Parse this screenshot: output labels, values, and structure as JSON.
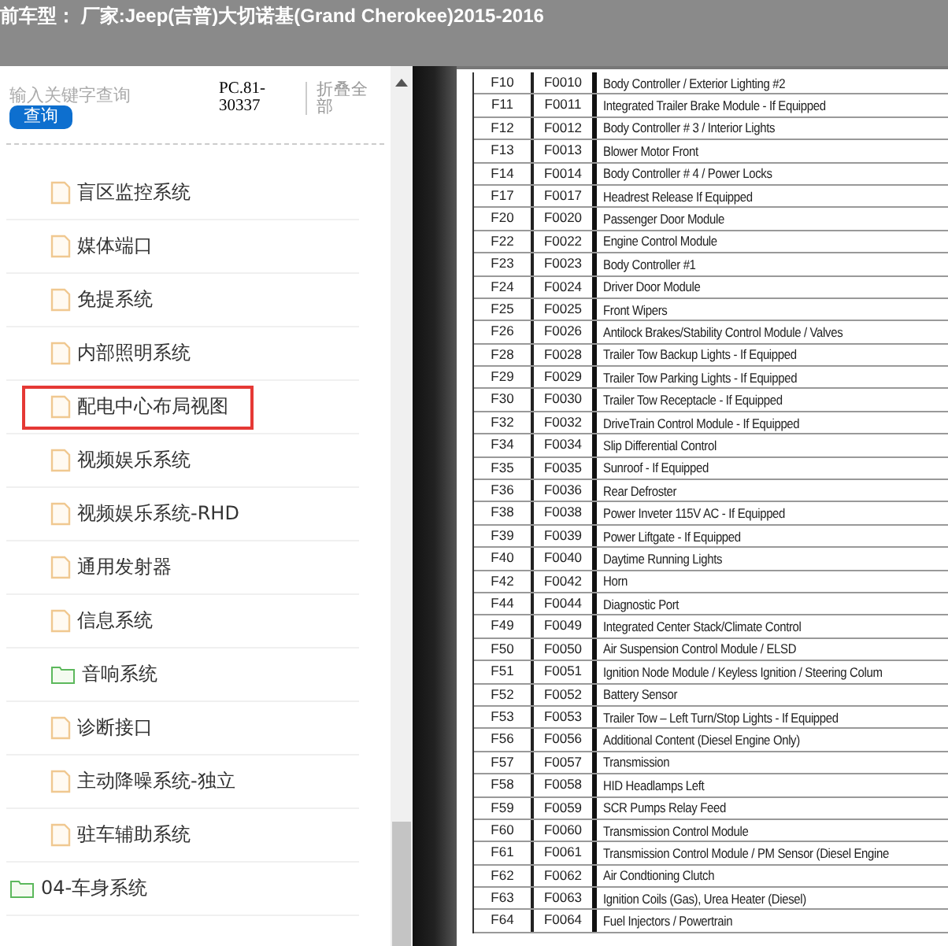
{
  "header": {
    "title": "前车型： 厂家:Jeep(吉普)大切诺基(Grand Cherokee)2015-2016"
  },
  "search": {
    "placeholder": "输入关键字查询",
    "button": "查询"
  },
  "code": "PC.81-30337",
  "collapse": "折叠全部",
  "tree": [
    {
      "kind": "group",
      "children": [
        {
          "label": "盲区监控系统",
          "kind": "file",
          "selected": false
        },
        {
          "label": "媒体端口",
          "kind": "file",
          "selected": false
        },
        {
          "label": "免提系统",
          "kind": "file",
          "selected": false
        },
        {
          "label": "内部照明系统",
          "kind": "file",
          "selected": false
        },
        {
          "label": "配电中心布局视图",
          "kind": "file",
          "selected": true
        },
        {
          "label": "视频娱乐系统",
          "kind": "file",
          "selected": false
        },
        {
          "label": "视频娱乐系统-RHD",
          "kind": "file",
          "selected": false
        },
        {
          "label": "通用发射器",
          "kind": "file",
          "selected": false
        },
        {
          "label": "信息系统",
          "kind": "file",
          "selected": false
        },
        {
          "label": "音响系统",
          "kind": "folder",
          "selected": false
        },
        {
          "label": "诊断接口",
          "kind": "file",
          "selected": false
        },
        {
          "label": "主动降噪系统-独立",
          "kind": "file",
          "selected": false
        },
        {
          "label": "驻车辅助系统",
          "kind": "file",
          "selected": false
        }
      ]
    },
    {
      "label": "04-车身系统",
      "kind": "folder",
      "selected": false
    }
  ],
  "fuse_table": {
    "rows": [
      [
        "F10",
        "F0010",
        "Body Controller / Exterior Lighting #2"
      ],
      [
        "F11",
        "F0011",
        "Integrated Trailer Brake Module - If Equipped"
      ],
      [
        "F12",
        "F0012",
        "Body Controller # 3 / Interior Lights"
      ],
      [
        "F13",
        "F0013",
        "Blower Motor Front"
      ],
      [
        "F14",
        "F0014",
        "Body Controller # 4 / Power Locks"
      ],
      [
        "F17",
        "F0017",
        "Headrest Release If Equipped"
      ],
      [
        "F20",
        "F0020",
        "Passenger Door Module"
      ],
      [
        "F22",
        "F0022",
        "Engine Control Module"
      ],
      [
        "F23",
        "F0023",
        "Body Controller #1"
      ],
      [
        "F24",
        "F0024",
        "Driver Door Module"
      ],
      [
        "F25",
        "F0025",
        "Front Wipers"
      ],
      [
        "F26",
        "F0026",
        "Antilock Brakes/Stability Control Module / Valves"
      ],
      [
        "F28",
        "F0028",
        "Trailer Tow Backup Lights - If Equipped"
      ],
      [
        "F29",
        "F0029",
        "Trailer Tow Parking Lights - If Equipped"
      ],
      [
        "F30",
        "F0030",
        "Trailer Tow Receptacle - If Equipped"
      ],
      [
        "F32",
        "F0032",
        "DriveTrain Control Module - If Equipped"
      ],
      [
        "F34",
        "F0034",
        "Slip Differential Control"
      ],
      [
        "F35",
        "F0035",
        "Sunroof - If Equipped"
      ],
      [
        "F36",
        "F0036",
        "Rear Defroster"
      ],
      [
        "F38",
        "F0038",
        "Power Inveter 115V AC - If Equipped"
      ],
      [
        "F39",
        "F0039",
        "Power Liftgate - If Equipped"
      ],
      [
        "F40",
        "F0040",
        "Daytime Running Lights"
      ],
      [
        "F42",
        "F0042",
        "Horn"
      ],
      [
        "F44",
        "F0044",
        "Diagnostic Port"
      ],
      [
        "F49",
        "F0049",
        "Integrated Center Stack/Climate Control"
      ],
      [
        "F50",
        "F0050",
        "Air Suspension Control Module / ELSD"
      ],
      [
        "F51",
        "F0051",
        "Ignition Node Module / Keyless Ignition / Steering Colum"
      ],
      [
        "F52",
        "F0052",
        "Battery Sensor"
      ],
      [
        "F53",
        "F0053",
        "Trailer Tow – Left Turn/Stop Lights - If Equipped"
      ],
      [
        "F56",
        "F0056",
        "Additional Content (Diesel Engine Only)"
      ],
      [
        "F57",
        "F0057",
        "Transmission"
      ],
      [
        "F58",
        "F0058",
        "HID Headlamps Left"
      ],
      [
        "F59",
        "F0059",
        "SCR Pumps Relay Feed"
      ],
      [
        "F60",
        "F0060",
        "Transmission Control Module"
      ],
      [
        "F61",
        "F0061",
        "Transmission Control Module / PM Sensor (Diesel Engine"
      ],
      [
        "F62",
        "F0062",
        "Air Condtioning Clutch"
      ],
      [
        "F63",
        "F0063",
        "Ignition Coils (Gas), Urea Heater (Diesel)"
      ],
      [
        "F64",
        "F0064",
        "Fuel Injectors / Powertrain"
      ]
    ]
  }
}
